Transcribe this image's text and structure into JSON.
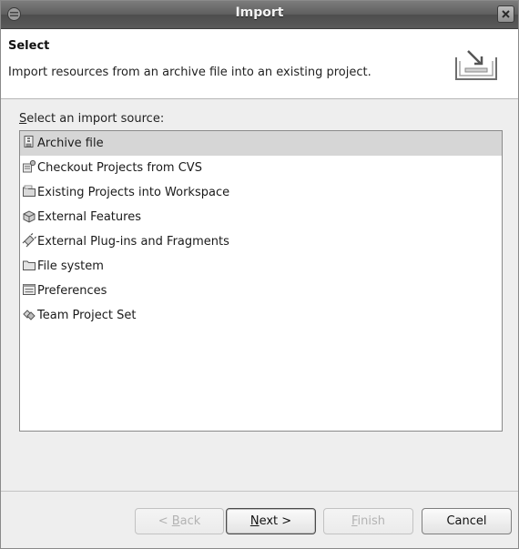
{
  "window": {
    "title": "Import"
  },
  "header": {
    "heading": "Select",
    "description": "Import resources from an archive file into an existing project."
  },
  "prompt": {
    "mnemonic": "S",
    "rest": "elect an import source:"
  },
  "sources": [
    {
      "label": "Archive file",
      "icon": "archive-file-icon",
      "selected": true
    },
    {
      "label": "Checkout Projects from CVS",
      "icon": "cvs-checkout-icon",
      "selected": false
    },
    {
      "label": "Existing Projects into Workspace",
      "icon": "existing-projects-icon",
      "selected": false
    },
    {
      "label": "External Features",
      "icon": "external-features-icon",
      "selected": false
    },
    {
      "label": "External Plug-ins and Fragments",
      "icon": "plugins-icon",
      "selected": false
    },
    {
      "label": "File system",
      "icon": "folder-icon",
      "selected": false
    },
    {
      "label": "Preferences",
      "icon": "preferences-icon",
      "selected": false
    },
    {
      "label": "Team Project Set",
      "icon": "team-project-set-icon",
      "selected": false
    }
  ],
  "buttons": {
    "back": {
      "pre": "< ",
      "mnemonic": "B",
      "post": "ack",
      "enabled": false
    },
    "next": {
      "pre": "",
      "mnemonic": "N",
      "post": "ext >",
      "enabled": true
    },
    "finish": {
      "pre": "",
      "mnemonic": "F",
      "post": "inish",
      "enabled": false
    },
    "cancel": {
      "label": "Cancel",
      "enabled": true
    }
  },
  "colors": {
    "titlebar": "#5e5e5e",
    "selection": "#d6d6d6",
    "dialog_bg": "#eeeeee"
  }
}
